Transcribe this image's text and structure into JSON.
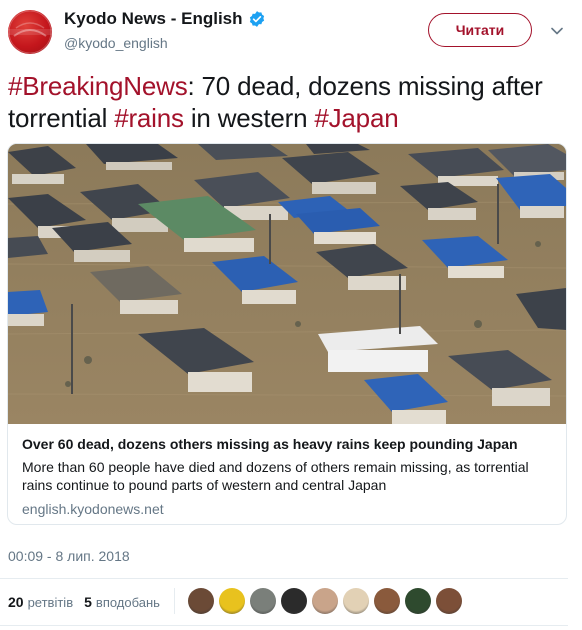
{
  "author": {
    "name": "Kyodo News - English",
    "handle": "@kyodo_english",
    "avatar_text_top": "KYODO",
    "avatar_text_bottom": "NEWS",
    "verified_icon": "verified-badge-icon",
    "brand_color": "#c4161c"
  },
  "follow_button": {
    "label": "Читати"
  },
  "tweet": {
    "parts": [
      {
        "text": "#BreakingNews",
        "hashtag": true
      },
      {
        "text": ": 70 dead, dozens missing after torrential ",
        "hashtag": false
      },
      {
        "text": "#rains",
        "hashtag": true
      },
      {
        "text": " in western ",
        "hashtag": false
      },
      {
        "text": "#Japan",
        "hashtag": true
      }
    ],
    "hashtag_color": "#a3122b"
  },
  "card": {
    "image_icon": "flooded-houses-photo",
    "title": "Over 60 dead, dozens others missing as heavy rains keep pounding Japan",
    "description": "More than 60 people have died and dozens of others remain missing, as torrential rains continue to pound parts of western and central Japan",
    "domain": "english.kyodonews.net"
  },
  "timestamp": "00:09 - 8 лип. 2018",
  "stats": {
    "retweets_count": "20",
    "retweets_label": "ретвітів",
    "likes_count": "5",
    "likes_label": "вподобань"
  },
  "likers": [
    {
      "icon": "liker-avatar-1",
      "color": "#6b4a36"
    },
    {
      "icon": "liker-avatar-2",
      "color": "#e8c21e"
    },
    {
      "icon": "liker-avatar-3",
      "color": "#7a7f7a"
    },
    {
      "icon": "liker-avatar-4",
      "color": "#2b2b2b"
    },
    {
      "icon": "liker-avatar-5",
      "color": "#c9a48a"
    },
    {
      "icon": "liker-avatar-6",
      "color": "#e2d1b5"
    },
    {
      "icon": "liker-avatar-7",
      "color": "#8a5a3c"
    },
    {
      "icon": "liker-avatar-8",
      "color": "#2e4a2e"
    },
    {
      "icon": "liker-avatar-9",
      "color": "#7c4f38"
    }
  ]
}
